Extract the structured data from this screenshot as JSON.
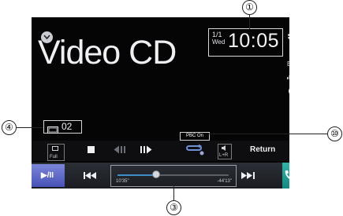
{
  "screen": {
    "source_title": "Video CD",
    "clock": {
      "date_top": "1/1",
      "date_bottom": "Wed",
      "time": "10:05"
    },
    "side_icons": {
      "settings": "gear-icon",
      "eq_label": "EQ",
      "search": "search-icon"
    },
    "track": {
      "number": "02"
    },
    "pbc_indicator": "PBC On",
    "controls": {
      "full_label": "Full",
      "stop": "stop-icon",
      "slow_reverse": "slow-reverse-icon",
      "slow_forward": "slow-forward-icon",
      "repeat": "repeat-icon",
      "lr_label": "L+R",
      "return_label": "Return"
    },
    "playback": {
      "play_pause_label": "▶/II",
      "elapsed": "10'35\"",
      "remaining": "-44'13\"",
      "progress": 0.35
    }
  },
  "callouts": [
    "①",
    "④",
    "⑩",
    "③"
  ],
  "colors": {
    "screen_bg": "#050505",
    "play_button": "#5560c6",
    "phone_button": "#1f9e93",
    "accent_blue": "#3e8ec7"
  }
}
